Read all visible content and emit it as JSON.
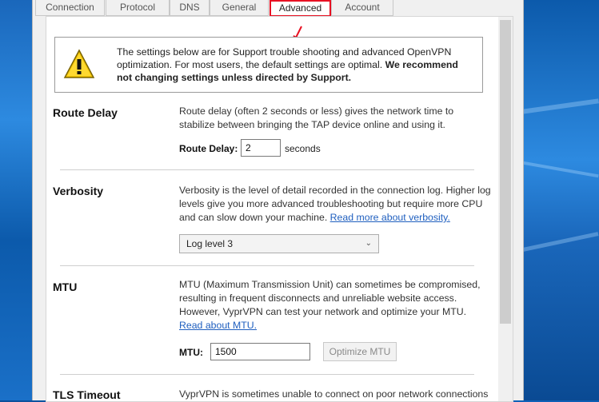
{
  "tabs": [
    {
      "label": "Connection"
    },
    {
      "label": "Protocol"
    },
    {
      "label": "DNS"
    },
    {
      "label": "General"
    },
    {
      "label": "Advanced"
    },
    {
      "label": "Account"
    }
  ],
  "warning": {
    "text": "The settings below are for Support trouble shooting and advanced OpenVPN optimization. For most users, the default settings are optimal.",
    "bold": "We recommend not changing settings unless directed by Support."
  },
  "route_delay": {
    "title": "Route Delay",
    "desc": "Route delay (often 2 seconds or less) gives the network time to stabilize between bringing the TAP device online and using it.",
    "label": "Route Delay:",
    "value": "2",
    "unit": "seconds"
  },
  "verbosity": {
    "title": "Verbosity",
    "desc": "Verbosity is the level of detail recorded in the connection log. Higher log levels give you more advanced troubleshooting but require more CPU and can slow down your machine.",
    "link": "Read more about verbosity.",
    "selected": "Log level 3"
  },
  "mtu": {
    "title": "MTU",
    "desc": "MTU (Maximum Transmission Unit) can sometimes be compromised, resulting in frequent disconnects and unreliable website access. However, VyprVPN can test your network and optimize your MTU.",
    "link": "Read about MTU.",
    "label": "MTU:",
    "value": "1500",
    "button": "Optimize MTU"
  },
  "tls": {
    "title": "TLS Timeout",
    "desc": "VyprVPN is sometimes unable to connect on poor network connections"
  },
  "colors": {
    "highlight": "#e81123",
    "link": "#1f5fbf",
    "warning_yellow": "#f5c400"
  },
  "icons": [
    "warning-icon",
    "red-arrow-icon",
    "chevron-down-icon"
  ]
}
